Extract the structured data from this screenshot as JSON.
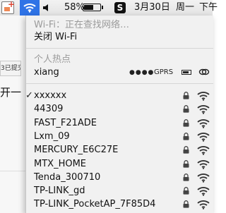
{
  "menubar": {
    "battery_percent": "58%",
    "battery_level": 0.58,
    "s_badge": "S",
    "date": "3月30日",
    "weekday": "周一",
    "time_partial": "下午"
  },
  "background_window": {
    "sent_label": "3已提交",
    "text": "开一"
  },
  "wifi_menu": {
    "status": "Wi-Fi：正在查找网络…",
    "turn_off": "关闭 Wi-Fi",
    "hotspot_heading": "个人热点",
    "hotspot": {
      "name": "xiang",
      "signal": "●●●●",
      "network_type": "GPRS",
      "battery_level": 0.8
    },
    "networks": [
      {
        "name": "xxxxxx",
        "connected": true,
        "locked": true
      },
      {
        "name": "44309",
        "connected": false,
        "locked": true
      },
      {
        "name": "FAST_F21ADE",
        "connected": false,
        "locked": true
      },
      {
        "name": "Lxm_09",
        "connected": false,
        "locked": true
      },
      {
        "name": "MERCURY_E6C27E",
        "connected": false,
        "locked": true
      },
      {
        "name": "MTX_HOME",
        "connected": false,
        "locked": true
      },
      {
        "name": "Tenda_300710",
        "connected": false,
        "locked": true
      },
      {
        "name": "TP-LINK_gd",
        "connected": false,
        "locked": true
      },
      {
        "name": "TP-LINK_PocketAP_7F85D4",
        "connected": false,
        "locked": true
      }
    ],
    "check_mark": "✓"
  }
}
